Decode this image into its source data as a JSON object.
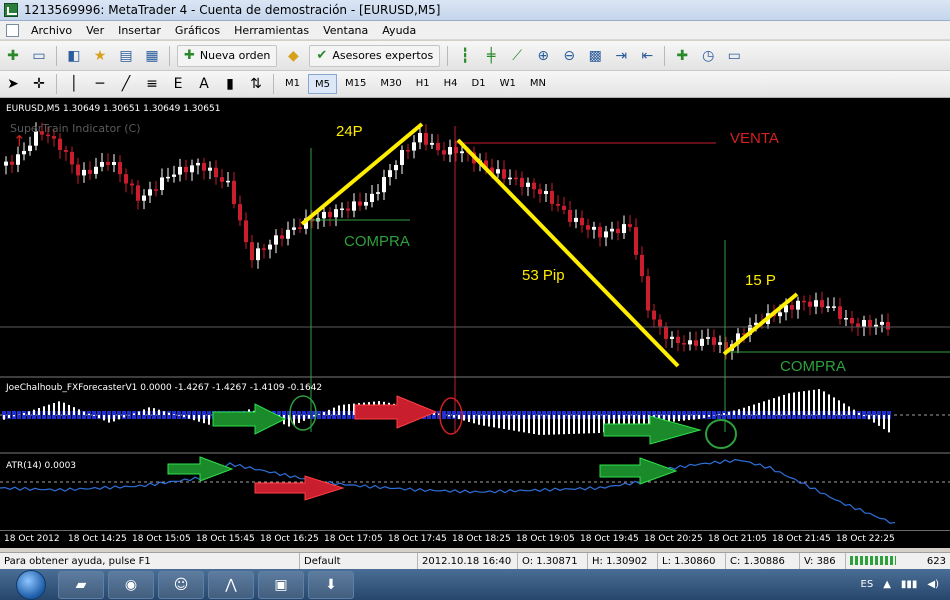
{
  "window": {
    "title": "1213569996: MetaTrader 4 - Cuenta de demostración - [EURUSD,M5]"
  },
  "menu": [
    "Archivo",
    "Ver",
    "Insertar",
    "Gráficos",
    "Herramientas",
    "Ventana",
    "Ayuda"
  ],
  "toolbar": {
    "new_order": "Nueva orden",
    "experts": "Asesores expertos"
  },
  "timeframes": [
    "M1",
    "M5",
    "M15",
    "M30",
    "H1",
    "H4",
    "D1",
    "W1",
    "MN"
  ],
  "active_timeframe": "M5",
  "chart": {
    "symbol_info": "EURUSD,M5  1.30649 1.30651 1.30649 1.30651",
    "indicator_main": "SuperTrain Indicator (C)",
    "annotations": {
      "a1": "24P",
      "a2": "COMPRA",
      "a3": "VENTA",
      "a4": "53 Pip",
      "a5": "15 P",
      "a6": "COMPRA"
    },
    "sub1_label": "JoeChalhoub_FXForecasterV1 0.0000 -1.4267 -1.4267 -1.4109 -0.1642",
    "sub2_label": "ATR(14) 0.0003"
  },
  "xaxis": [
    "18 Oct 2012",
    "18 Oct 14:25",
    "18 Oct 15:05",
    "18 Oct 15:45",
    "18 Oct 16:25",
    "18 Oct 17:05",
    "18 Oct 17:45",
    "18 Oct 18:25",
    "18 Oct 19:05",
    "18 Oct 19:45",
    "18 Oct 20:25",
    "18 Oct 21:05",
    "18 Oct 21:45",
    "18 Oct 22:25"
  ],
  "status": {
    "help": "Para obtener ayuda, pulse F1",
    "profile": "Default",
    "datetime": "2012.10.18 16:40",
    "open": "O: 1.30871",
    "high": "H: 1.30902",
    "low": "L: 1.30860",
    "close": "C: 1.30886",
    "volume": "V: 386",
    "extra": "623"
  },
  "taskbar": {
    "lang": "ES"
  },
  "colors": {
    "up": "#ffffff",
    "down": "#c81e2e",
    "yellow": "#ffee00",
    "green_text": "#2f9f3e",
    "red_text": "#d42020",
    "atr": "#2e6fd8"
  }
}
